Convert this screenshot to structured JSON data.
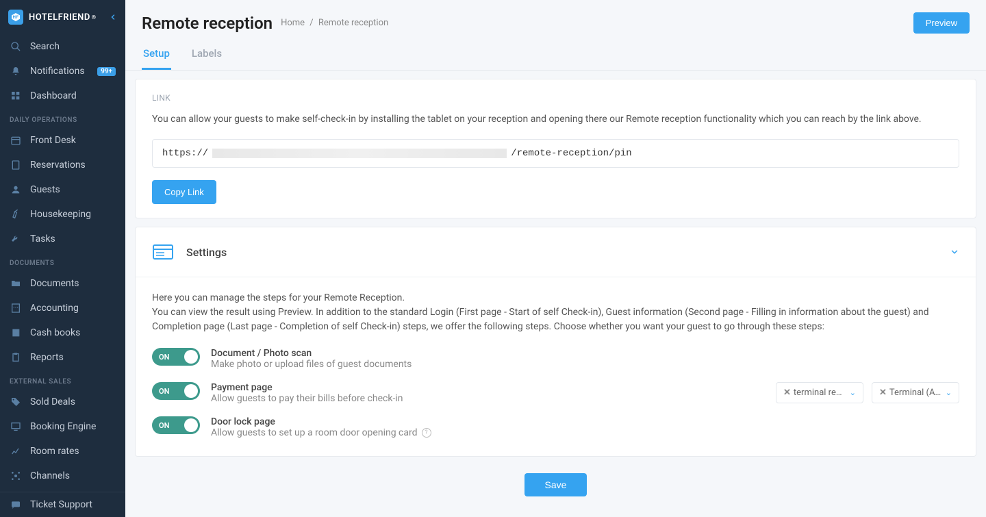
{
  "brand": {
    "name": "HOTELFRIEND"
  },
  "sidebar": {
    "search": "Search",
    "notifications": "Notifications",
    "notifications_badge": "99+",
    "dashboard": "Dashboard",
    "sections": {
      "daily_ops": "DAILY OPERATIONS",
      "documents": "DOCUMENTS",
      "external_sales": "EXTERNAL SALES"
    },
    "front_desk": "Front Desk",
    "reservations": "Reservations",
    "guests": "Guests",
    "housekeeping": "Housekeeping",
    "tasks": "Tasks",
    "docs": "Documents",
    "accounting": "Accounting",
    "cash_books": "Cash books",
    "reports": "Reports",
    "sold_deals": "Sold Deals",
    "booking_engine": "Booking Engine",
    "room_rates": "Room rates",
    "channels": "Channels",
    "ticket_support": "Ticket Support"
  },
  "header": {
    "title": "Remote reception",
    "breadcrumb_home": "Home",
    "breadcrumb_current": "Remote reception",
    "preview": "Preview"
  },
  "tabs": {
    "setup": "Setup",
    "labels": "Labels"
  },
  "link_card": {
    "label": "LINK",
    "desc": "You can allow your guests to make self-check-in by installing the tablet on your reception and opening there our Remote reception functionality which you can reach by the link above.",
    "url_prefix": "https://",
    "url_suffix": "/remote-reception/pin",
    "copy": "Copy Link"
  },
  "settings": {
    "title": "Settings",
    "desc_line1": "Here you can manage the steps for your Remote Reception.",
    "desc_line2": "You can view the result using Preview. In addition to the standard Login (First page - Start of self Check-in), Guest information (Second page - Filling in information about the guest) and Completion page (Last page - Completion of self Check-in) steps, we offer the following steps. Choose whether you want your guest to go through these steps:",
    "toggle_on": "ON",
    "doc_scan": {
      "title": "Document / Photo scan",
      "sub": "Make photo or upload files of guest documents"
    },
    "payment": {
      "title": "Payment page",
      "sub": "Allow guests to pay their bills before check-in"
    },
    "door": {
      "title": "Door lock page",
      "sub": "Allow guests to set up a room door opening card"
    },
    "dropdown1": "terminal recep…",
    "dropdown2": "Terminal (Ady…"
  },
  "save": "Save"
}
